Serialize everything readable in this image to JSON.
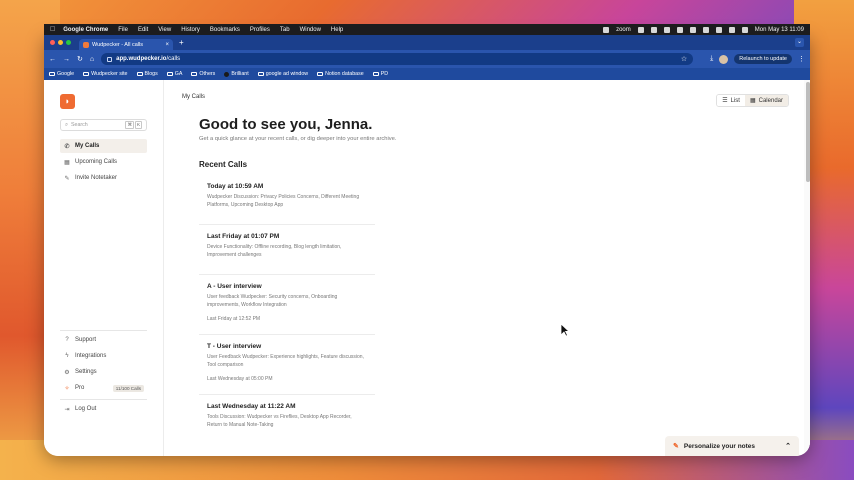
{
  "menubar": {
    "apple": "",
    "items": [
      "Google Chrome",
      "File",
      "Edit",
      "View",
      "History",
      "Bookmarks",
      "Profiles",
      "Tab",
      "Window",
      "Help"
    ],
    "zoom_label": "zoom",
    "clock": "Mon May 13  11:09"
  },
  "browser": {
    "tab_title": "Wudpecker - All calls",
    "url_host": "app.wudpecker.io",
    "url_path": "/calls",
    "relaunch_label": "Relaunch to update",
    "bookmarks": [
      "Google",
      "Wudpecker site",
      "Blogs",
      "GA",
      "Others",
      "Brilliant",
      "google ad window",
      "Notion database",
      "PD"
    ]
  },
  "sidebar": {
    "search_placeholder": "Search",
    "search_keys": [
      "⌘",
      "K"
    ],
    "nav": [
      {
        "label": "My Calls"
      },
      {
        "label": "Upcoming Calls"
      },
      {
        "label": "Invite Notetaker"
      }
    ],
    "bottom": [
      {
        "label": "Support"
      },
      {
        "label": "Integrations"
      },
      {
        "label": "Settings"
      },
      {
        "label": "Pro",
        "badge": "11/100 Calls"
      },
      {
        "label": "Log Out"
      }
    ]
  },
  "main": {
    "breadcrumb": "My Calls",
    "view_toggle": {
      "list": "List",
      "calendar": "Calendar"
    },
    "greeting": "Good to see you, Jenna.",
    "subtitle": "Get a quick glance at your recent calls, or dig deeper into your entire archive.",
    "section_title": "Recent Calls",
    "calls": [
      {
        "title": "Today at 10:59 AM",
        "summary": "Wudpecker Discussion: Privacy Policies Concerns, Different Meeting Platforms, Upcoming Desktop App",
        "time": ""
      },
      {
        "title": "Last Friday at 01:07 PM",
        "summary": "Device Functionality: Offline recording, Blog length limitation, Improvement challenges",
        "time": ""
      },
      {
        "title": "A - User interview",
        "summary": "User feedback Wudpecker: Security concerns, Onboarding improvements, Workflow Integration",
        "time": "Last Friday at 12:52 PM"
      },
      {
        "title": "T - User interview",
        "summary": "User Feedback Wudpecker: Experience highlights, Feature discussion, Tool comparison",
        "time": "Last Wednesday at 05:00 PM"
      },
      {
        "title": "Last Wednesday at 11:22 AM",
        "summary": "Tools Discussion: Wudpecker vs Fireflies, Desktop App Recorder, Return to Manual Note-Taking",
        "time": ""
      }
    ],
    "notes_panel": "Personalize your notes"
  },
  "colors": {
    "brand_orange": "#ef6b32",
    "chrome_blue": "#2a55ad",
    "active_nav_bg": "#f3efea"
  }
}
